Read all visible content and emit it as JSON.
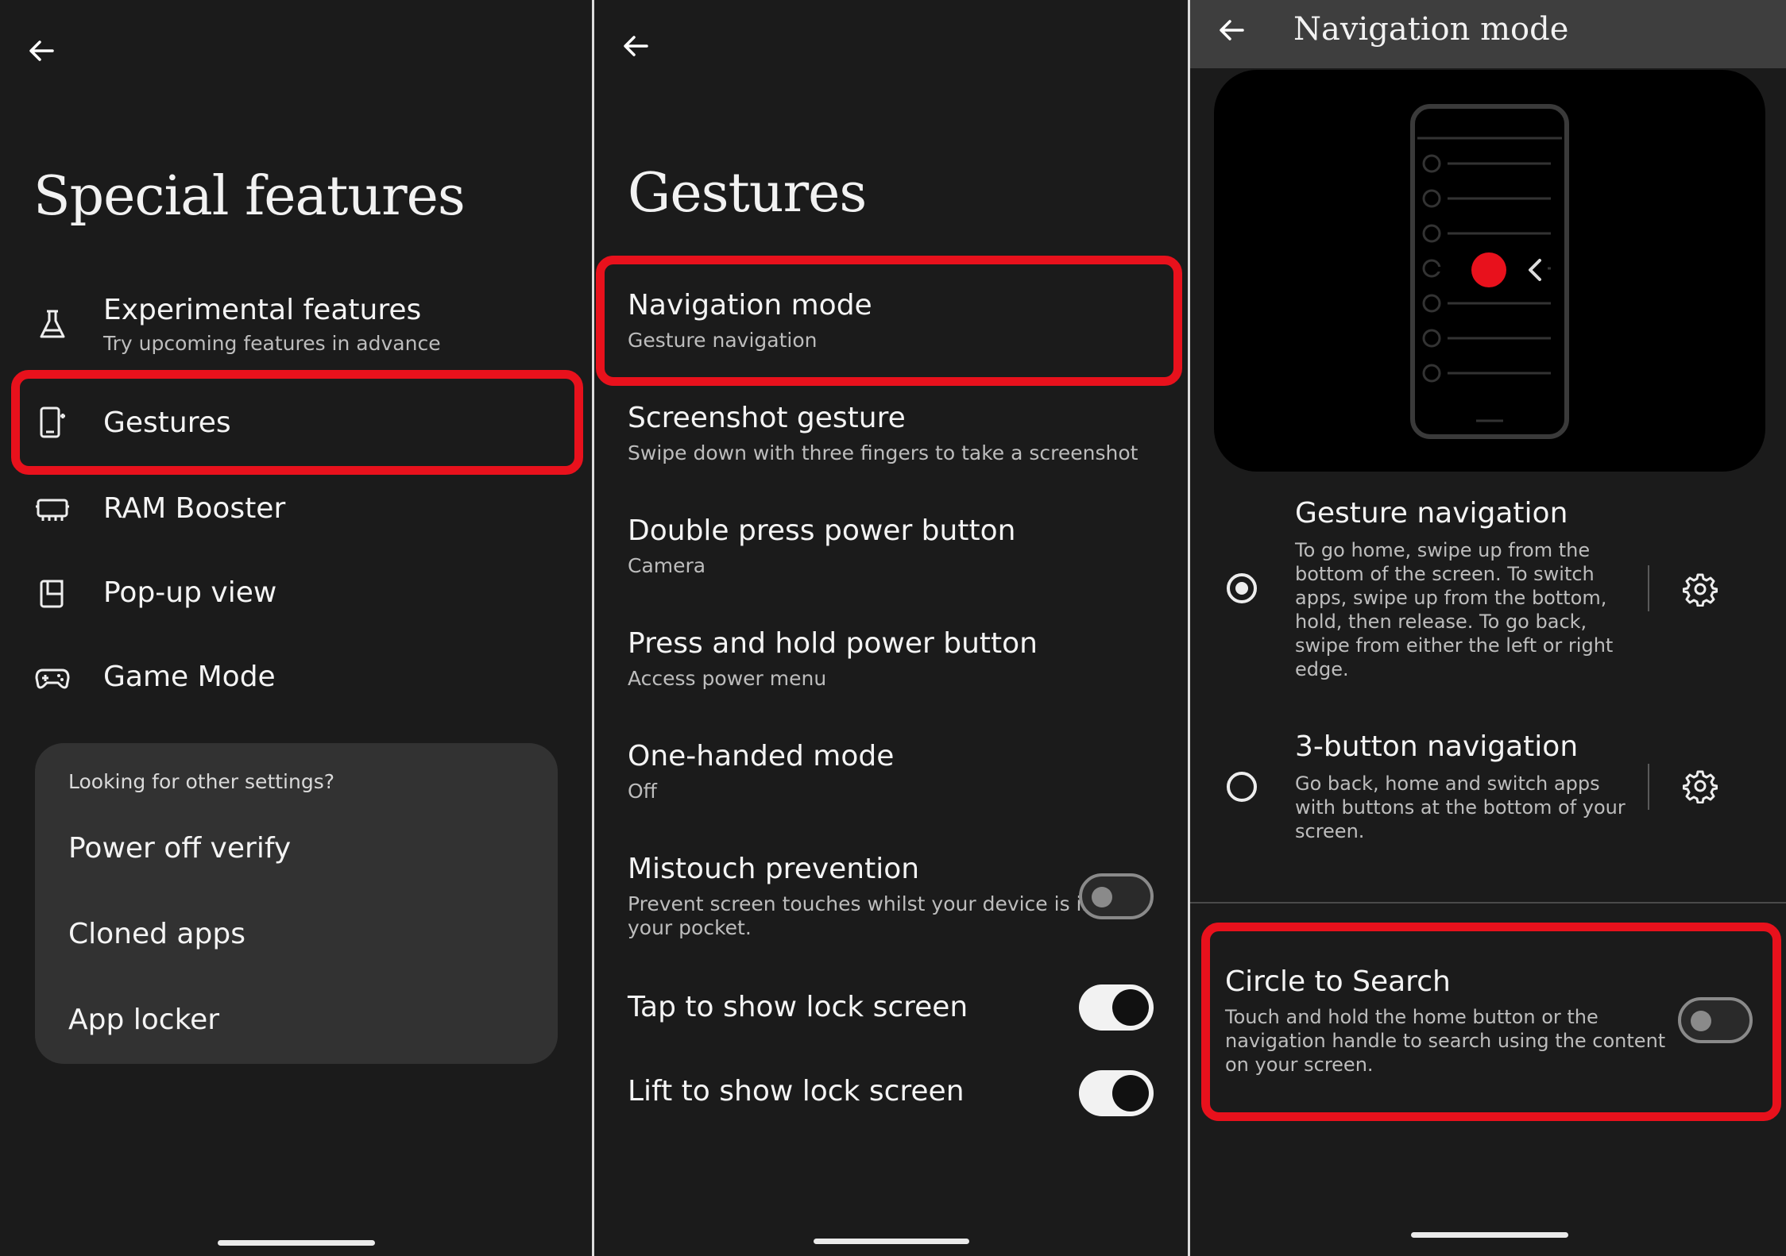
{
  "panel1": {
    "title": "Special features",
    "items": [
      {
        "label": "Experimental features",
        "sub": "Try upcoming features in advance",
        "icon": "flask-icon"
      },
      {
        "label": "Gestures",
        "icon": "phone-gesture-icon"
      },
      {
        "label": "RAM Booster",
        "icon": "memory-icon"
      },
      {
        "label": "Pop-up view",
        "icon": "popup-window-icon"
      },
      {
        "label": "Game Mode",
        "icon": "gamepad-icon"
      }
    ],
    "other_card": {
      "heading": "Looking for other settings?",
      "items": [
        "Power off verify",
        "Cloned apps",
        "App locker"
      ]
    }
  },
  "panel2": {
    "title": "Gestures",
    "items": [
      {
        "label": "Navigation mode",
        "sub": "Gesture navigation"
      },
      {
        "label": "Screenshot gesture",
        "sub": "Swipe down with three fingers to take a screenshot"
      },
      {
        "label": "Double press power button",
        "sub": "Camera"
      },
      {
        "label": "Press and hold power button",
        "sub": "Access power menu"
      },
      {
        "label": "One-handed mode",
        "sub": "Off"
      },
      {
        "label": "Mistouch prevention",
        "sub_line1": "Prevent screen touches whilst your device is in",
        "sub_line2": "your pocket.",
        "toggle": "off"
      },
      {
        "label": "Tap to show lock screen",
        "toggle": "on"
      },
      {
        "label": "Lift to show lock screen",
        "toggle": "on"
      }
    ]
  },
  "panel3": {
    "title": "Navigation mode",
    "options": [
      {
        "label": "Gesture navigation",
        "selected": true,
        "desc": [
          "To go home, swipe up from the",
          "bottom of the screen. To switch",
          "apps, swipe up from the bottom,",
          "hold, then release. To go back,",
          "swipe from either the left or right",
          "edge."
        ]
      },
      {
        "label": "3-button navigation",
        "selected": false,
        "desc": [
          "Go back, home and switch apps",
          "with buttons at the bottom of your",
          "screen."
        ]
      }
    ],
    "circle_to_search": {
      "label": "Circle to Search",
      "desc": [
        "Touch and hold the home button or the",
        "navigation handle to search using the content",
        "on your screen."
      ],
      "toggle": "off"
    }
  },
  "colors": {
    "background": "#1b1b1b",
    "highlight": "#e8111c",
    "card": "#323232",
    "preview_dot": "#e8111c"
  }
}
